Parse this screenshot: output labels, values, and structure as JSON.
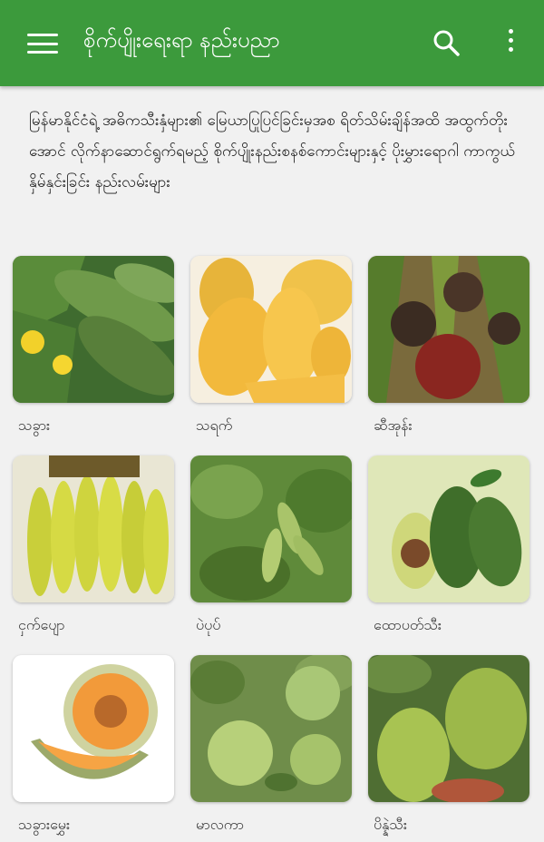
{
  "appbar": {
    "title": "စိုက်ပျိုးရေးရာ နည်းပညာ",
    "menu_icon": "menu-icon",
    "search_icon": "search-icon",
    "more_icon": "more-vert-icon",
    "color": "#3c9a3c"
  },
  "intro": "မြန်မာနိုင်ငံရဲ့ အဓိကသီးနှံများ၏ မြေယာပြုပြင်ခြင်းမှအစ ရိတ်သိမ်းချိန်အထိ အထွက်တိုးအောင် လိုက်နာဆောင်ရွက်ရမည့် စိုက်ပျိုးနည်းစနစ်ကောင်းများနှင့် ပိုးမွှားရောဂါ ကာကွယ်နှိမ်နှင်းခြင်း နည်းလမ်းများ",
  "crops": [
    {
      "label": "သခွား",
      "icon": "cucumber-image"
    },
    {
      "label": "သရက်",
      "icon": "mango-image"
    },
    {
      "label": "ဆီအုန်း",
      "icon": "oil-palm-image"
    },
    {
      "label": "ငှက်ပျော",
      "icon": "banana-image"
    },
    {
      "label": "ပဲပုပ်",
      "icon": "soybean-image"
    },
    {
      "label": "ထောပတ်သီး",
      "icon": "avocado-image"
    },
    {
      "label": "သခွားမွှေး",
      "icon": "melon-image"
    },
    {
      "label": "မာလကာ",
      "icon": "guava-image"
    },
    {
      "label": "ပိန္နဲသီး",
      "icon": "jackfruit-image"
    }
  ]
}
